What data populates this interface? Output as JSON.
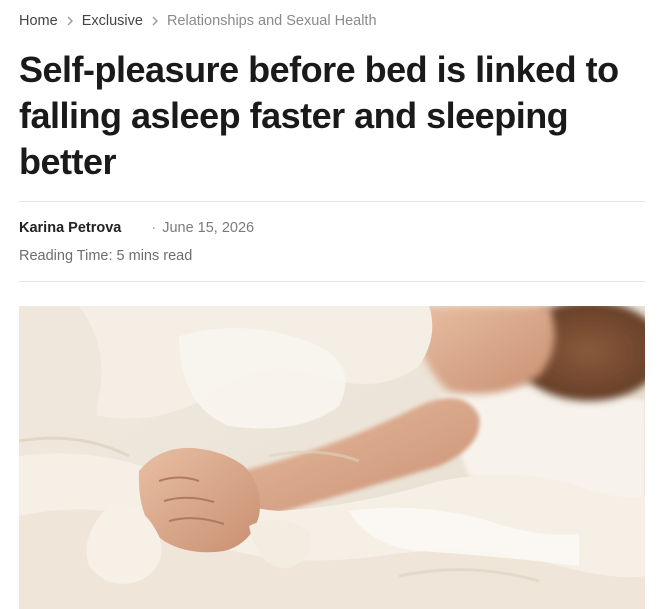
{
  "breadcrumb": {
    "items": [
      {
        "label": "Home"
      },
      {
        "label": "Exclusive"
      },
      {
        "label": "Relationships and Sexual Health"
      }
    ]
  },
  "article": {
    "title": "Self-pleasure before bed is linked to falling asleep faster and sleeping better",
    "author": "Karina Petrova",
    "date_separator": "·",
    "date": "June 15, 2026",
    "reading_time": "Reading Time: 5 mins read"
  },
  "hero_image": {
    "subject": "person lying in bed under a white duvet, hand gripping the sheet"
  },
  "icons": {
    "breadcrumb_separator": "chevron-right-icon"
  },
  "colors": {
    "text": "#1a1a1a",
    "muted": "#7a7a7a",
    "divider": "#e6e6e6"
  }
}
